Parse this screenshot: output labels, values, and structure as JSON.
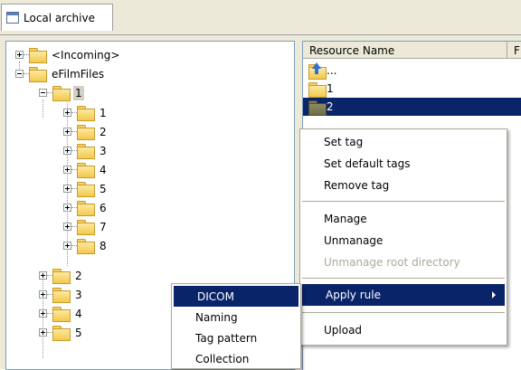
{
  "tab": {
    "label": "Local archive",
    "icon": "window-icon"
  },
  "tree": {
    "incoming": "<Incoming>",
    "root": "eFilmFiles",
    "selected_node": "1",
    "children_of_1": [
      "1",
      "2",
      "3",
      "4",
      "5",
      "6",
      "7",
      "8"
    ],
    "siblings": [
      "2",
      "3",
      "4",
      "5"
    ]
  },
  "resources": {
    "column_name": "Resource Name",
    "column_second": "F",
    "rows": [
      "...",
      "1",
      "2"
    ]
  },
  "context_menu": {
    "items": [
      "Set tag",
      "Set default tags",
      "Remove tag",
      "Manage",
      "Unmanage",
      "Unmanage root directory",
      "Apply rule",
      "Upload"
    ]
  },
  "submenu": {
    "items": [
      "DICOM",
      "Naming",
      "Tag pattern",
      "Collection"
    ]
  },
  "colors": {
    "selection": "#0a246a",
    "chrome": "#ece9d8",
    "border": "#7f9db9"
  }
}
